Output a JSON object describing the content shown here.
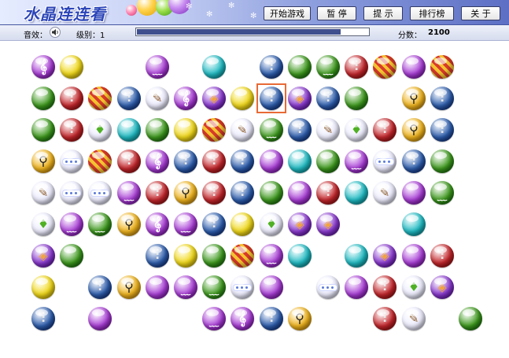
{
  "header": {
    "title": "水晶连连看",
    "buttons": {
      "start": "开始游戏",
      "pause": "暂 停",
      "hint": "提 示",
      "ranking": "排行榜",
      "about": "关 于"
    }
  },
  "status": {
    "sound_label": "音效：",
    "level_label": "级别：1",
    "time_progress": 0.88,
    "score_label": "分数：",
    "score_value": "2100"
  },
  "board": {
    "selected": {
      "row": 1,
      "col": 8
    },
    "gem_colors": {
      "purple": "#a93fd6",
      "yellow": "#f1d91a",
      "teal": "#21bcc4",
      "gray": "#b8b8b8",
      "green": "#3f9a1f",
      "red": "#c4282d",
      "orange": "#f2a43b",
      "violet": "#8b3bd0",
      "blue": "#2f5fae",
      "stripe": "#d83a2a",
      "clock": "#f0b51f",
      "white": "#eeeeff"
    },
    "icons": {
      "note": "treble-clef-icon",
      "zip": "zipper-icon",
      "feather": "feather-icon",
      "bulb": "lightbulb-icon",
      "person": "walking-person-icon",
      "dots": "dots-icon",
      "stripe": "stripes-icon",
      "swirl": "swirl-icon",
      "drip": "drip-icon"
    },
    "grid": [
      [
        "pN",
        "yP",
        null,
        null,
        "pD",
        null,
        "tP",
        null,
        "zB",
        "gP",
        "gD",
        "zR",
        "sR",
        "pP",
        "sR"
      ],
      [
        "gP",
        "zR",
        "sR",
        "zB",
        "fO",
        "pN",
        "bV",
        "yP",
        "zB",
        "bV",
        "zB",
        "gP",
        null,
        "kY",
        "zB"
      ],
      [
        "gP",
        "zR",
        "lG",
        "tP",
        "gP",
        "yP",
        "sR",
        "fO",
        "gD",
        "zB",
        "fO",
        "lG",
        "zR",
        "kY",
        "zB"
      ],
      [
        "kY",
        "wD",
        "sR",
        "zR",
        "pN",
        "zB",
        "zR",
        "zB",
        "pP",
        "tP",
        "gP",
        "pD",
        "wD",
        "zB",
        "gP"
      ],
      [
        "fO",
        "wD",
        "wD",
        "pD",
        "zR",
        "kY",
        "zR",
        "zB",
        "gP",
        "pP",
        "zR",
        "tP",
        "fO",
        "pP",
        "gD"
      ],
      [
        "lG",
        "pD",
        "gD",
        "kY",
        "pN",
        "pD",
        "zB",
        "yP",
        "lG",
        "bV",
        "bV",
        null,
        null,
        "tP",
        null
      ],
      [
        "bV",
        "gP",
        null,
        null,
        "zB",
        "yP",
        "gP",
        "sR",
        "pD",
        "tP",
        null,
        "tP",
        "bV",
        "pP",
        "zR"
      ],
      [
        "yP",
        null,
        "zB",
        "kY",
        "pP",
        "pD",
        "gD",
        "wD",
        "pP",
        null,
        "wD",
        "pP",
        "zR",
        "lG",
        "bV"
      ],
      [
        "zB",
        null,
        "pP",
        null,
        null,
        null,
        "pD",
        "pN",
        "zB",
        "kY",
        null,
        null,
        "zR",
        "fO",
        null,
        "gP"
      ]
    ]
  }
}
